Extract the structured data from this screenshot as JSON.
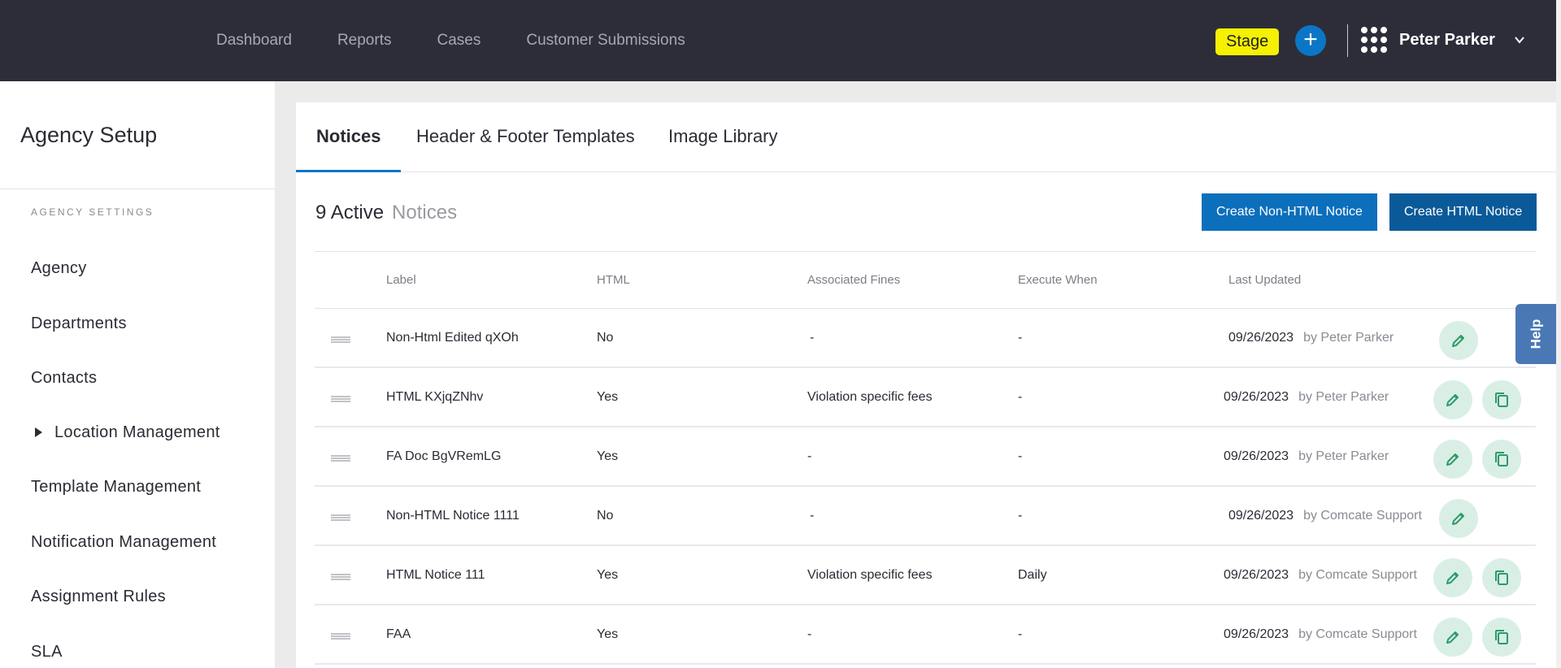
{
  "topbar": {
    "nav": [
      "Dashboard",
      "Reports",
      "Cases",
      "Customer Submissions"
    ],
    "stage_badge": "Stage",
    "add_icon": "plus-icon",
    "apps_icon": "grid-icon",
    "user_name": "Peter Parker",
    "user_menu_icon": "chevron-down-icon"
  },
  "sidebar": {
    "title": "Agency Setup",
    "section_label": "AGENCY SETTINGS",
    "items": [
      "Agency",
      "Departments",
      "Contacts",
      "Location Management",
      "Template Management",
      "Notification Management",
      "Assignment Rules",
      "SLA"
    ]
  },
  "tabs": [
    "Notices",
    "Header & Footer Templates",
    "Image Library"
  ],
  "summary": {
    "count": "9 Active",
    "label": "Notices"
  },
  "buttons": {
    "create_non_html": "Create Non-HTML Notice",
    "create_html": "Create HTML Notice"
  },
  "table": {
    "columns": [
      "Label",
      "HTML",
      "Associated Fines",
      "Execute When",
      "Last Updated"
    ],
    "rows": [
      {
        "label": "Non-Html Edited qXOh",
        "html": "No",
        "fines": "-",
        "execute": "-",
        "date": "09/26/2023",
        "by": "by Peter Parker"
      },
      {
        "label": "HTML KXjqZNhv",
        "html": "Yes",
        "fines": "Violation specific fees",
        "execute": "-",
        "date": "09/26/2023",
        "by": "by Peter Parker"
      },
      {
        "label": "FA Doc BgVRemLG",
        "html": "Yes",
        "fines": "-",
        "execute": "-",
        "date": "09/26/2023",
        "by": "by Peter Parker"
      },
      {
        "label": "Non-HTML Notice 1111",
        "html": "No",
        "fines": "-",
        "execute": "-",
        "date": "09/26/2023",
        "by": "by Comcate Support"
      },
      {
        "label": "HTML Notice 111",
        "html": "Yes",
        "fines": "Violation specific fees",
        "execute": "Daily",
        "date": "09/26/2023",
        "by": "by Comcate Support"
      },
      {
        "label": "FAA",
        "html": "Yes",
        "fines": "-",
        "execute": "-",
        "date": "09/26/2023",
        "by": "by Comcate Support"
      }
    ]
  },
  "help": "Help",
  "colors": {
    "accent": "#0b76c6",
    "topbar": "#2d2d3a",
    "stage": "#f5f100",
    "icon_bg": "#d9efe5",
    "icon_fg": "#2e9a6a"
  }
}
